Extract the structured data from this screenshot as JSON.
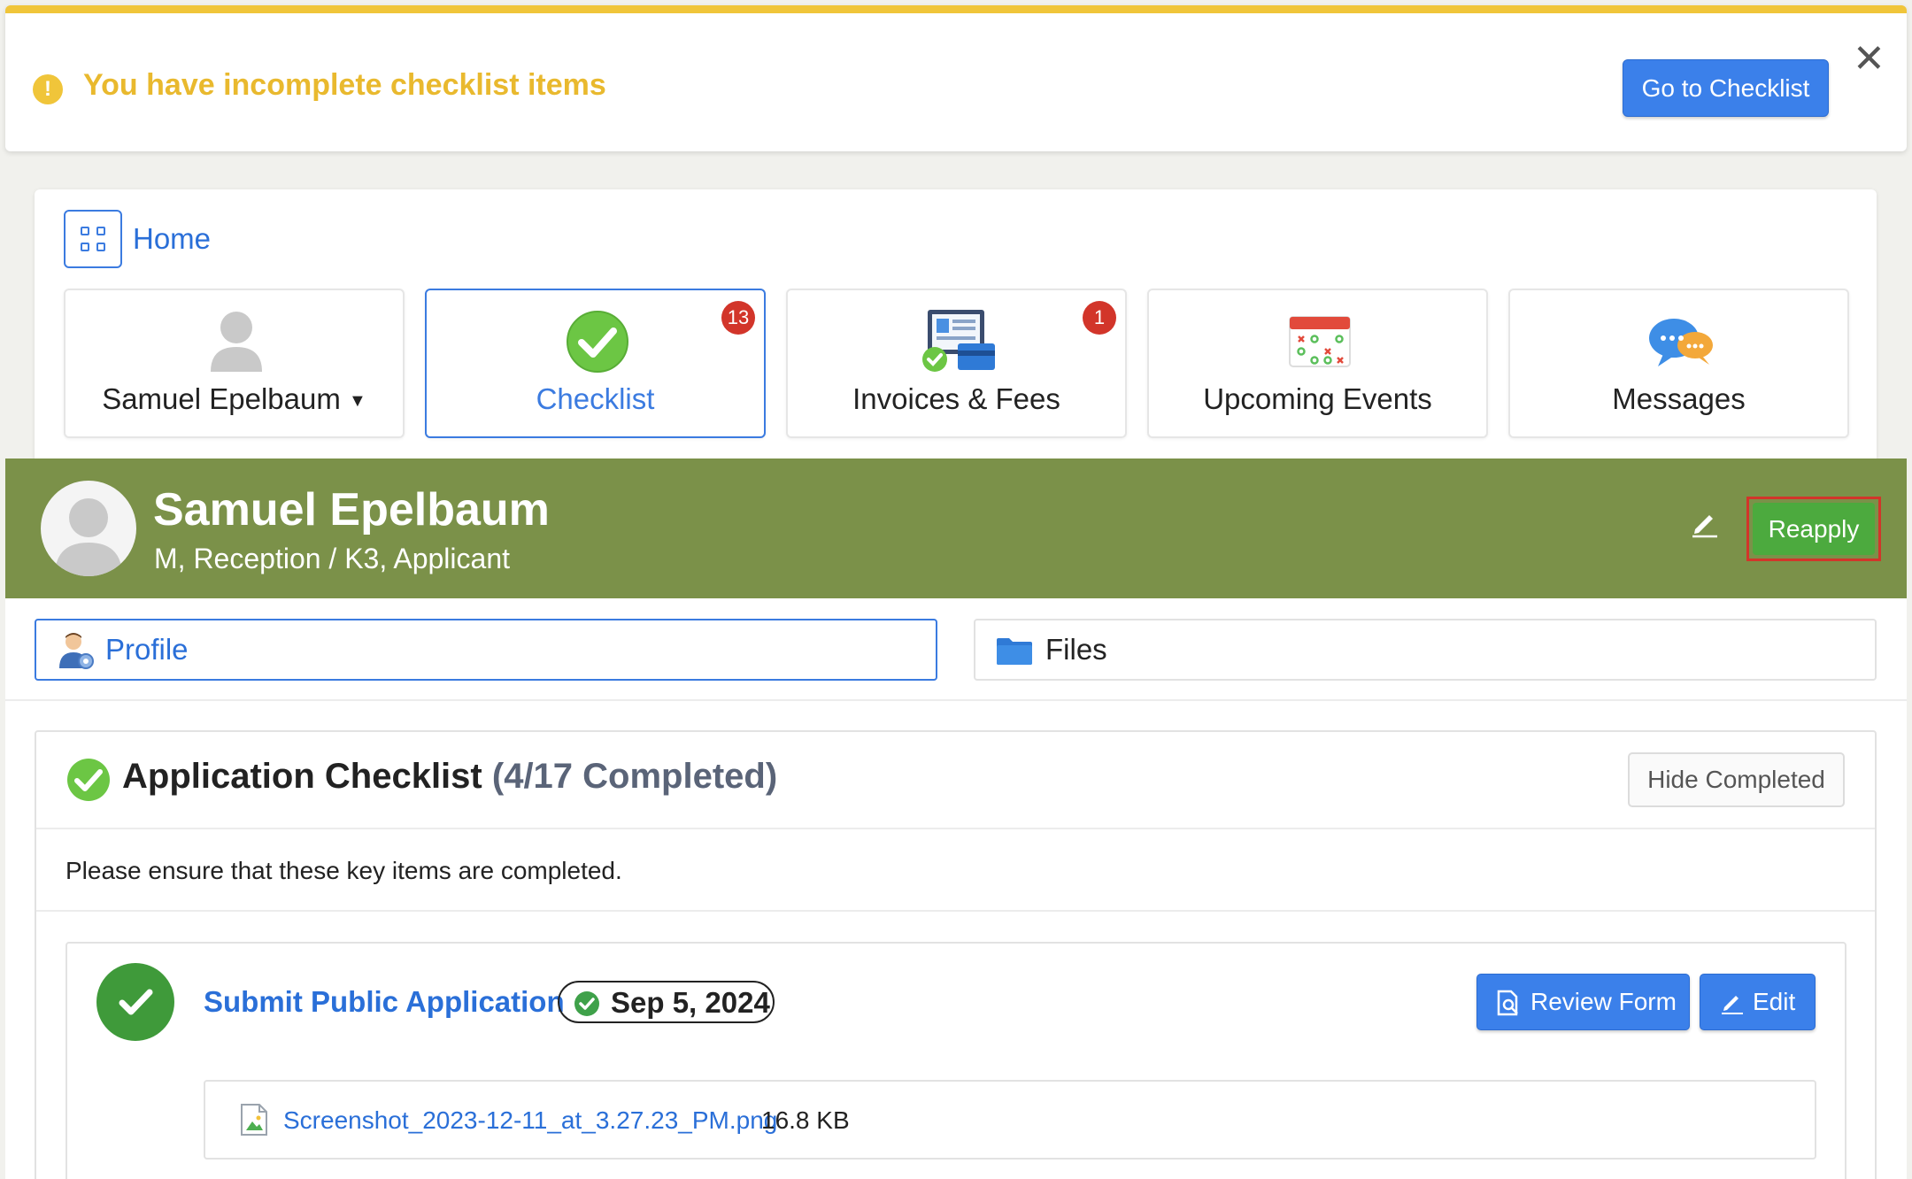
{
  "alert": {
    "message": "You have incomplete checklist items",
    "button_label": "Go to Checklist",
    "accent_color": "#f0c53a",
    "icon": "warning-icon"
  },
  "breadcrumb": {
    "home_label": "Home",
    "icon": "grid-icon"
  },
  "tiles": [
    {
      "label": "Samuel Epelbaum",
      "icon": "user-avatar-icon",
      "dropdown": true
    },
    {
      "label": "Checklist",
      "icon": "check-circle-icon",
      "badge": "13",
      "active": true
    },
    {
      "label": "Invoices & Fees",
      "icon": "invoice-icon",
      "badge": "1"
    },
    {
      "label": "Upcoming Events",
      "icon": "calendar-icon"
    },
    {
      "label": "Messages",
      "icon": "chat-bubbles-icon"
    }
  ],
  "student": {
    "name": "Samuel Epelbaum",
    "details": "M, Reception / K3, Applicant",
    "reapply_label": "Reapply",
    "banner_color": "#7b9149"
  },
  "tabs": {
    "profile_label": "Profile",
    "files_label": "Files"
  },
  "checklist": {
    "title": "Application Checklist",
    "count": "(4/17 Completed)",
    "hide_label": "Hide Completed",
    "note": "Please ensure that these key items are completed.",
    "item": {
      "title": "Submit Public Application",
      "date": "Sep 5, 2024",
      "review_label": "Review Form",
      "edit_label": "Edit",
      "file_name": "Screenshot_2023-12-11_at_3.27.23_PM.png",
      "file_size": "16.8 KB"
    }
  }
}
